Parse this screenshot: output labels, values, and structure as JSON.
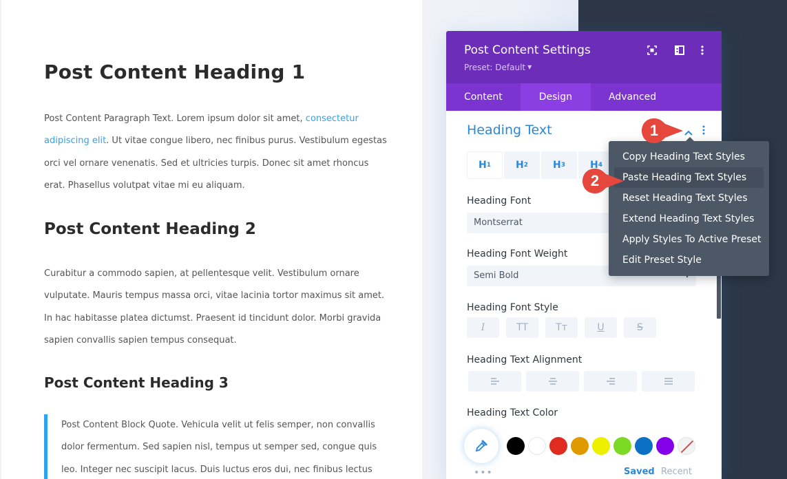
{
  "post": {
    "heading1": "Post Content Heading 1",
    "paragraph1_before_link": "Post Content Paragraph Text. Lorem ipsum dolor sit amet, ",
    "paragraph1_link": "consectetur adipiscing elit",
    "paragraph1_after_link": ". Ut vitae congue libero, nec finibus purus. Vestibulum egestas orci vel ornare venenatis. Sed et ultricies turpis. Donec sit amet rhoncus erat. Phasellus volutpat vitae mi eu aliquam.",
    "heading2": "Post Content Heading 2",
    "paragraph2": "Curabitur a commodo sapien, at pellentesque velit. Vestibulum ornare vulputate. Mauris tempus massa orci, vitae lacinia tortor maximus sit amet. In hac habitasse platea dictumst. Praesent id tincidunt dolor. Morbi gravida sapien convallis sapien tempus consequat.",
    "heading3": "Post Content Heading 3",
    "blockquote": "Post Content Block Quote. Vehicula velit ut felis semper, non convallis dolor fermentum. Sed sapien nisl, tempus ut semper sed, congue quis leo. Integer nec suscipit lacus. Duis luctus eros dui, nec finibus lectus"
  },
  "panel": {
    "title": "Post Content Settings",
    "preset": "Preset: Default",
    "header_icons": [
      "expand-icon",
      "split-view-icon",
      "more-options-icon"
    ],
    "tabs": [
      {
        "label": "Content",
        "active": false
      },
      {
        "label": "Design",
        "active": true
      },
      {
        "label": "Advanced",
        "active": false
      }
    ],
    "section_title": "Heading Text",
    "heading_tabs": [
      {
        "label": "H",
        "sub": "1",
        "active": true
      },
      {
        "label": "H",
        "sub": "2",
        "active": false
      },
      {
        "label": "H",
        "sub": "3",
        "active": false
      },
      {
        "label": "H",
        "sub": "4",
        "active": false
      }
    ],
    "heading_font_label": "Heading Font",
    "heading_font_value": "Montserrat",
    "heading_font_weight_label": "Heading Font Weight",
    "heading_font_weight_value": "Semi Bold",
    "heading_font_style_label": "Heading Font Style",
    "font_style_buttons": [
      "I",
      "TT",
      "Tт",
      "U",
      "S"
    ],
    "heading_text_alignment_label": "Heading Text Alignment",
    "alignment_buttons": [
      "align-left",
      "align-center",
      "align-right",
      "align-justify"
    ],
    "heading_text_color_label": "Heading Text Color",
    "color_swatches": [
      "#000000",
      "#ffffff",
      "#e02b20",
      "#e09900",
      "#edf000",
      "#7cda24",
      "#0c71c3",
      "#8300e9",
      "none"
    ],
    "color_tabs": {
      "saved": "Saved",
      "recent": "Recent"
    },
    "picker_more": "•••"
  },
  "context_menu": {
    "items": [
      {
        "label": "Copy Heading Text Styles",
        "hover": false
      },
      {
        "label": "Paste Heading Text Styles",
        "hover": true
      },
      {
        "label": "Reset Heading Text Styles",
        "hover": false
      },
      {
        "label": "Extend Heading Text Styles",
        "hover": false
      },
      {
        "label": "Apply Styles To Active Preset",
        "hover": false
      },
      {
        "label": "Edit Preset Style",
        "hover": false
      }
    ]
  },
  "callouts": [
    {
      "number": "1"
    },
    {
      "number": "2"
    }
  ],
  "colors": {
    "panel_header": "#6c2eb9",
    "tabs_bar": "#7b34cf",
    "active_tab": "#8b3fe3",
    "accent_blue": "#2b87da",
    "link_blue": "#2ea3f2",
    "menu_bg": "#4c5866",
    "callout_red": "#e5473c"
  }
}
